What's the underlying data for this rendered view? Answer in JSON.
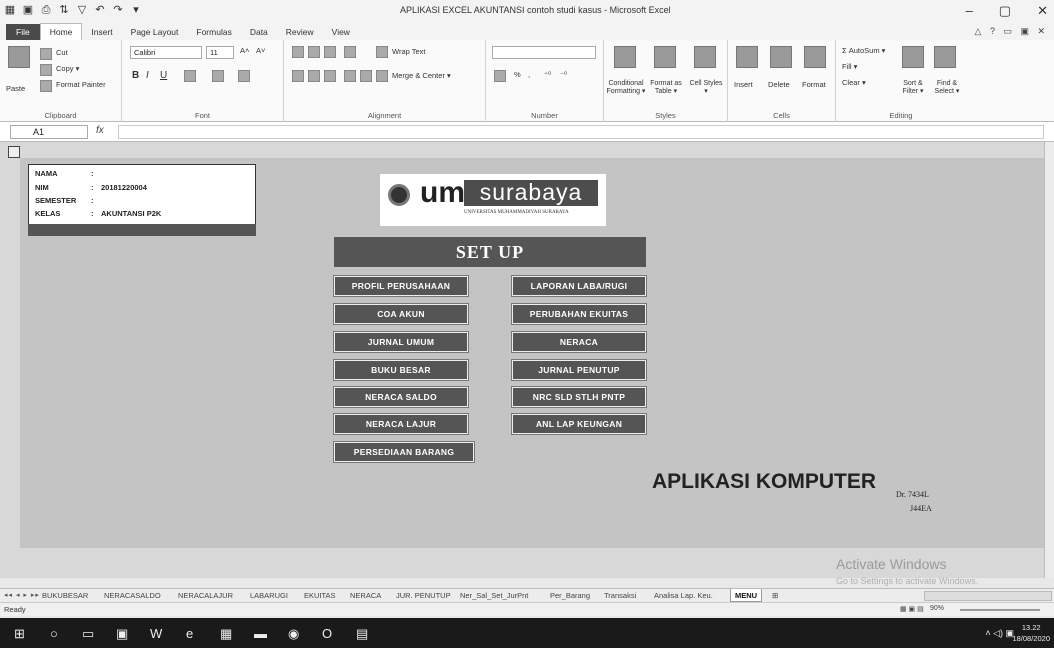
{
  "window": {
    "title": "APLIKASI EXCEL AKUNTANSI contoh studi kasus - Microsoft Excel",
    "min": "–",
    "max": "▢",
    "close": "✕"
  },
  "tabs": [
    "Home",
    "Insert",
    "Page Layout",
    "Formulas",
    "Data",
    "Review",
    "View"
  ],
  "file_tab": "File",
  "ribbon": {
    "clipboard": {
      "paste": "Paste",
      "cut": "Cut",
      "copy": "Copy ▾",
      "format_painter": "Format Painter",
      "label": "Clipboard"
    },
    "font": {
      "name": "Calibri",
      "size": "11",
      "grow": "A˄",
      "shrink": "A˅",
      "bold": "B",
      "italic": "I",
      "underline": "U",
      "label": "Font"
    },
    "alignment": {
      "wrap": "Wrap Text",
      "merge": "Merge & Center ▾",
      "label": "Alignment"
    },
    "number": {
      "format": "",
      "label": "Number",
      "percent": "%",
      "comma": ",",
      "inc": "⁺⁰",
      "dec": "⁻⁰"
    },
    "styles": {
      "conditional": "Conditional Formatting ▾",
      "format_table": "Format as Table ▾",
      "cell_styles": "Cell Styles ▾",
      "label": "Styles"
    },
    "cells": {
      "insert": "Insert",
      "delete": "Delete",
      "format": "Format",
      "label": "Cells"
    },
    "editing": {
      "autosum": "Σ AutoSum ▾",
      "fill": "Fill ▾",
      "clear": "Clear ▾",
      "sort": "Sort & Filter ▾",
      "find": "Find & Select ▾",
      "label": "Editing"
    }
  },
  "formula_bar": {
    "name_box": "A1",
    "fx": "fx",
    "value": ""
  },
  "info": {
    "nama_label": "NAMA",
    "nama_value": "",
    "nim_label": "NIM",
    "nim_value": "20181220004",
    "semester_label": "SEMESTER",
    "semester_value": "",
    "kelas_label": "KELAS",
    "kelas_value": "AKUNTANSI P2K",
    "colon": ":"
  },
  "logo": {
    "um": "um",
    "surabaya": "surabaya",
    "subtitle": "UNIVERSITAS MUHAMMADIYAH SURABAYA"
  },
  "setup_title": "SET UP",
  "menu_left": [
    "PROFIL PERUSAHAAN",
    "COA AKUN",
    "JURNAL UMUM",
    "BUKU BESAR",
    "NERACA SALDO",
    "NERACA LAJUR",
    "PERSEDIAAN BARANG"
  ],
  "menu_right": [
    "LAPORAN LABA/RUGI",
    "PERUBAHAN EKUITAS",
    "NERACA",
    "JURNAL PENUTUP",
    "NRC SLD STLH PNTP",
    "ANL LAP KEUNGAN"
  ],
  "app_name": "APLIKASI KOMPUTER",
  "author_prefix": "Dr. 7434L",
  "author_code": "J44EA",
  "activate": {
    "line1": "Activate Windows",
    "line2": "Go to Settings to activate Windows."
  },
  "sheet_tabs": [
    "BUKUBESAR",
    "NERACASALDO",
    "NERACALAJUR",
    "LABARUGI",
    "EKUITAS",
    "NERACA",
    "JUR. PENUTUP",
    "Ner_Sal_Set_JurPnt",
    "Per_Barang",
    "Transaksi",
    "Analisa Lap. Keu.",
    "MENU"
  ],
  "active_sheet": "MENU",
  "status": {
    "ready": "Ready",
    "zoom": "90%"
  },
  "clock": {
    "time": "13.22",
    "date": "18/08/2020"
  }
}
